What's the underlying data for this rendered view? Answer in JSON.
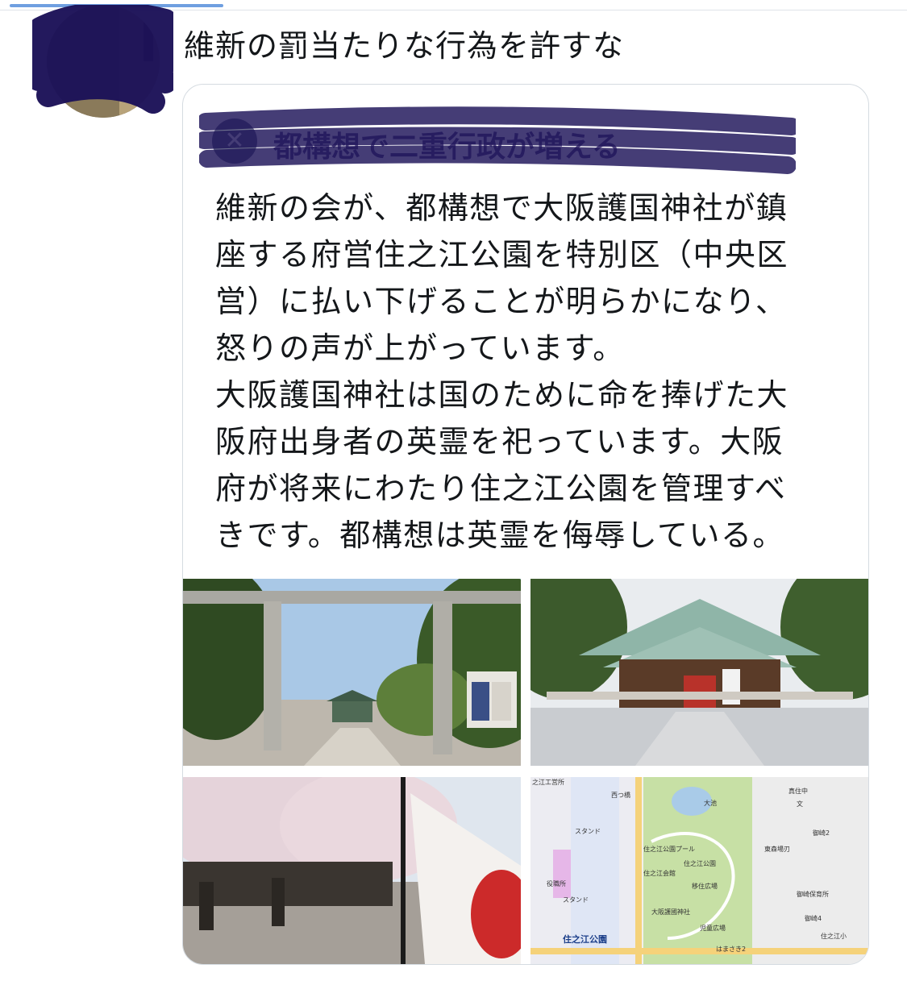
{
  "tweet": {
    "text": "維新の罰当たりな行為を許すな"
  },
  "quote": {
    "author_name": "都構想で二重行政が増える",
    "author_icon": "party-logo-icon",
    "body_lines": [
      "維新の会が、都構想で大阪護国神社が鎮",
      "座する府営住之江公園を特別区（中央区",
      "営）に払い下げることが明らかになり、",
      "怒りの声が上がっています。",
      "大阪護国神社は国のために命を捧げた大",
      "阪府出身者の英霊を祀っています。大阪",
      "府が将来にわたり住之江公園を管理すべ",
      "きです。都構想は英霊を侮辱している。"
    ]
  },
  "map": {
    "labels": {
      "top_left": "之江工営所",
      "true_south": "真住中",
      "bunkyo": "文",
      "goryo2": "御崎2",
      "daichi": "大池",
      "nishi_bridge": "西つ橋",
      "stand1": "スタンド",
      "pool": "住之江公園プール",
      "kyogi": "東森場刃",
      "kaikan": "住之江会館",
      "park_center": "住之江公園",
      "plaza": "移住広場",
      "office": "役職所",
      "stand2": "スタンド",
      "shrine": "大阪護國神社",
      "goryo_school": "御崎保育所",
      "goryo4": "御崎4",
      "kids_plaza": "児童広場",
      "station": "住之江公園",
      "sumie_sho": "住之江小",
      "hama2": "はまさき2"
    }
  },
  "colors": {
    "text": "#14171a",
    "border": "#d5dbe1",
    "scribble": "#1c1258",
    "link_accent": "#6f9fe0"
  }
}
